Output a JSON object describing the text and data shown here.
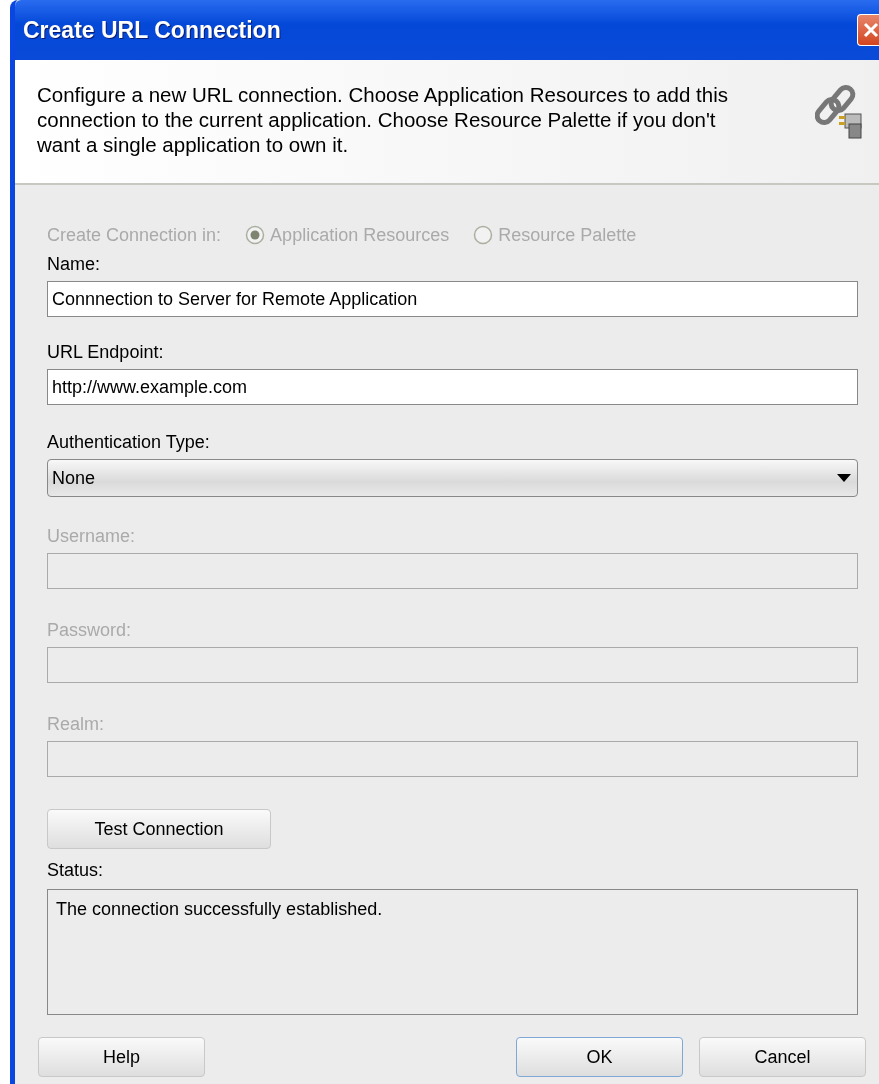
{
  "window": {
    "title": "Create URL Connection"
  },
  "header": {
    "description": "Configure a new URL connection.  Choose Application Resources to add this connection to the current application. Choose Resource Palette if you don't want a single application to own it."
  },
  "location": {
    "label": "Create Connection in:",
    "disabled": true,
    "options": [
      {
        "label": "Application Resources",
        "selected": true
      },
      {
        "label": "Resource Palette",
        "selected": false
      }
    ]
  },
  "fields": [
    {
      "kind": "text",
      "label": "Name:",
      "value": "Connnection to Server for Remote Application",
      "disabled": false
    },
    {
      "kind": "text",
      "label": "URL Endpoint:",
      "value": "http://www.example.com",
      "disabled": false
    },
    {
      "kind": "select",
      "label": "Authentication Type:",
      "value": "None",
      "disabled": false
    },
    {
      "kind": "text",
      "label": "Username:",
      "disabled": true
    },
    {
      "kind": "text",
      "label": "Password:",
      "disabled": true
    },
    {
      "kind": "text",
      "label": "Realm:",
      "disabled": true
    }
  ],
  "test_button": {
    "label": "Test Connection"
  },
  "status": {
    "label": "Status:",
    "text": "The connection successfully established."
  },
  "buttons": [
    {
      "label": "Help",
      "default": false
    },
    {
      "label": "OK",
      "default": true
    },
    {
      "label": "Cancel",
      "default": false
    }
  ]
}
